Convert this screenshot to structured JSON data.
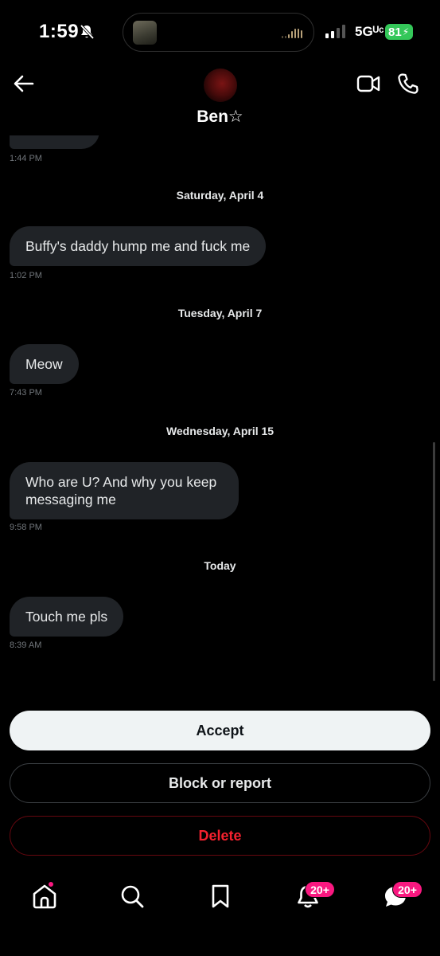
{
  "status_bar": {
    "time": "1:59",
    "network": "5Gᵁᶜ",
    "battery": "81"
  },
  "header": {
    "contact_name": "Ben☆"
  },
  "messages": [
    {
      "date_separator": "",
      "text": "",
      "time": "1:44 PM"
    },
    {
      "date_separator": "Saturday, April 4",
      "text": "Buffy's daddy hump me and fuck me",
      "time": "1:02 PM"
    },
    {
      "date_separator": "Tuesday, April 7",
      "text": "Meow",
      "time": "7:43 PM"
    },
    {
      "date_separator": "Wednesday, April 15",
      "text": "Who are U? And why you keep messaging me",
      "time": "9:58 PM"
    },
    {
      "date_separator": "Today",
      "text": "Touch me pls",
      "time": "8:39 AM"
    }
  ],
  "actions": {
    "accept": "Accept",
    "block_or_report": "Block or report",
    "delete": "Delete"
  },
  "bottom_nav": {
    "home_icon": "home-icon",
    "search_icon": "search-icon",
    "bookmark_icon": "bookmark-icon",
    "notifications_badge": "20+",
    "messages_badge": "20+"
  },
  "colors": {
    "accent_pink": "#f91880",
    "delete_red": "#f4212e",
    "bubble_bg": "#202327",
    "battery_green": "#34c759"
  }
}
